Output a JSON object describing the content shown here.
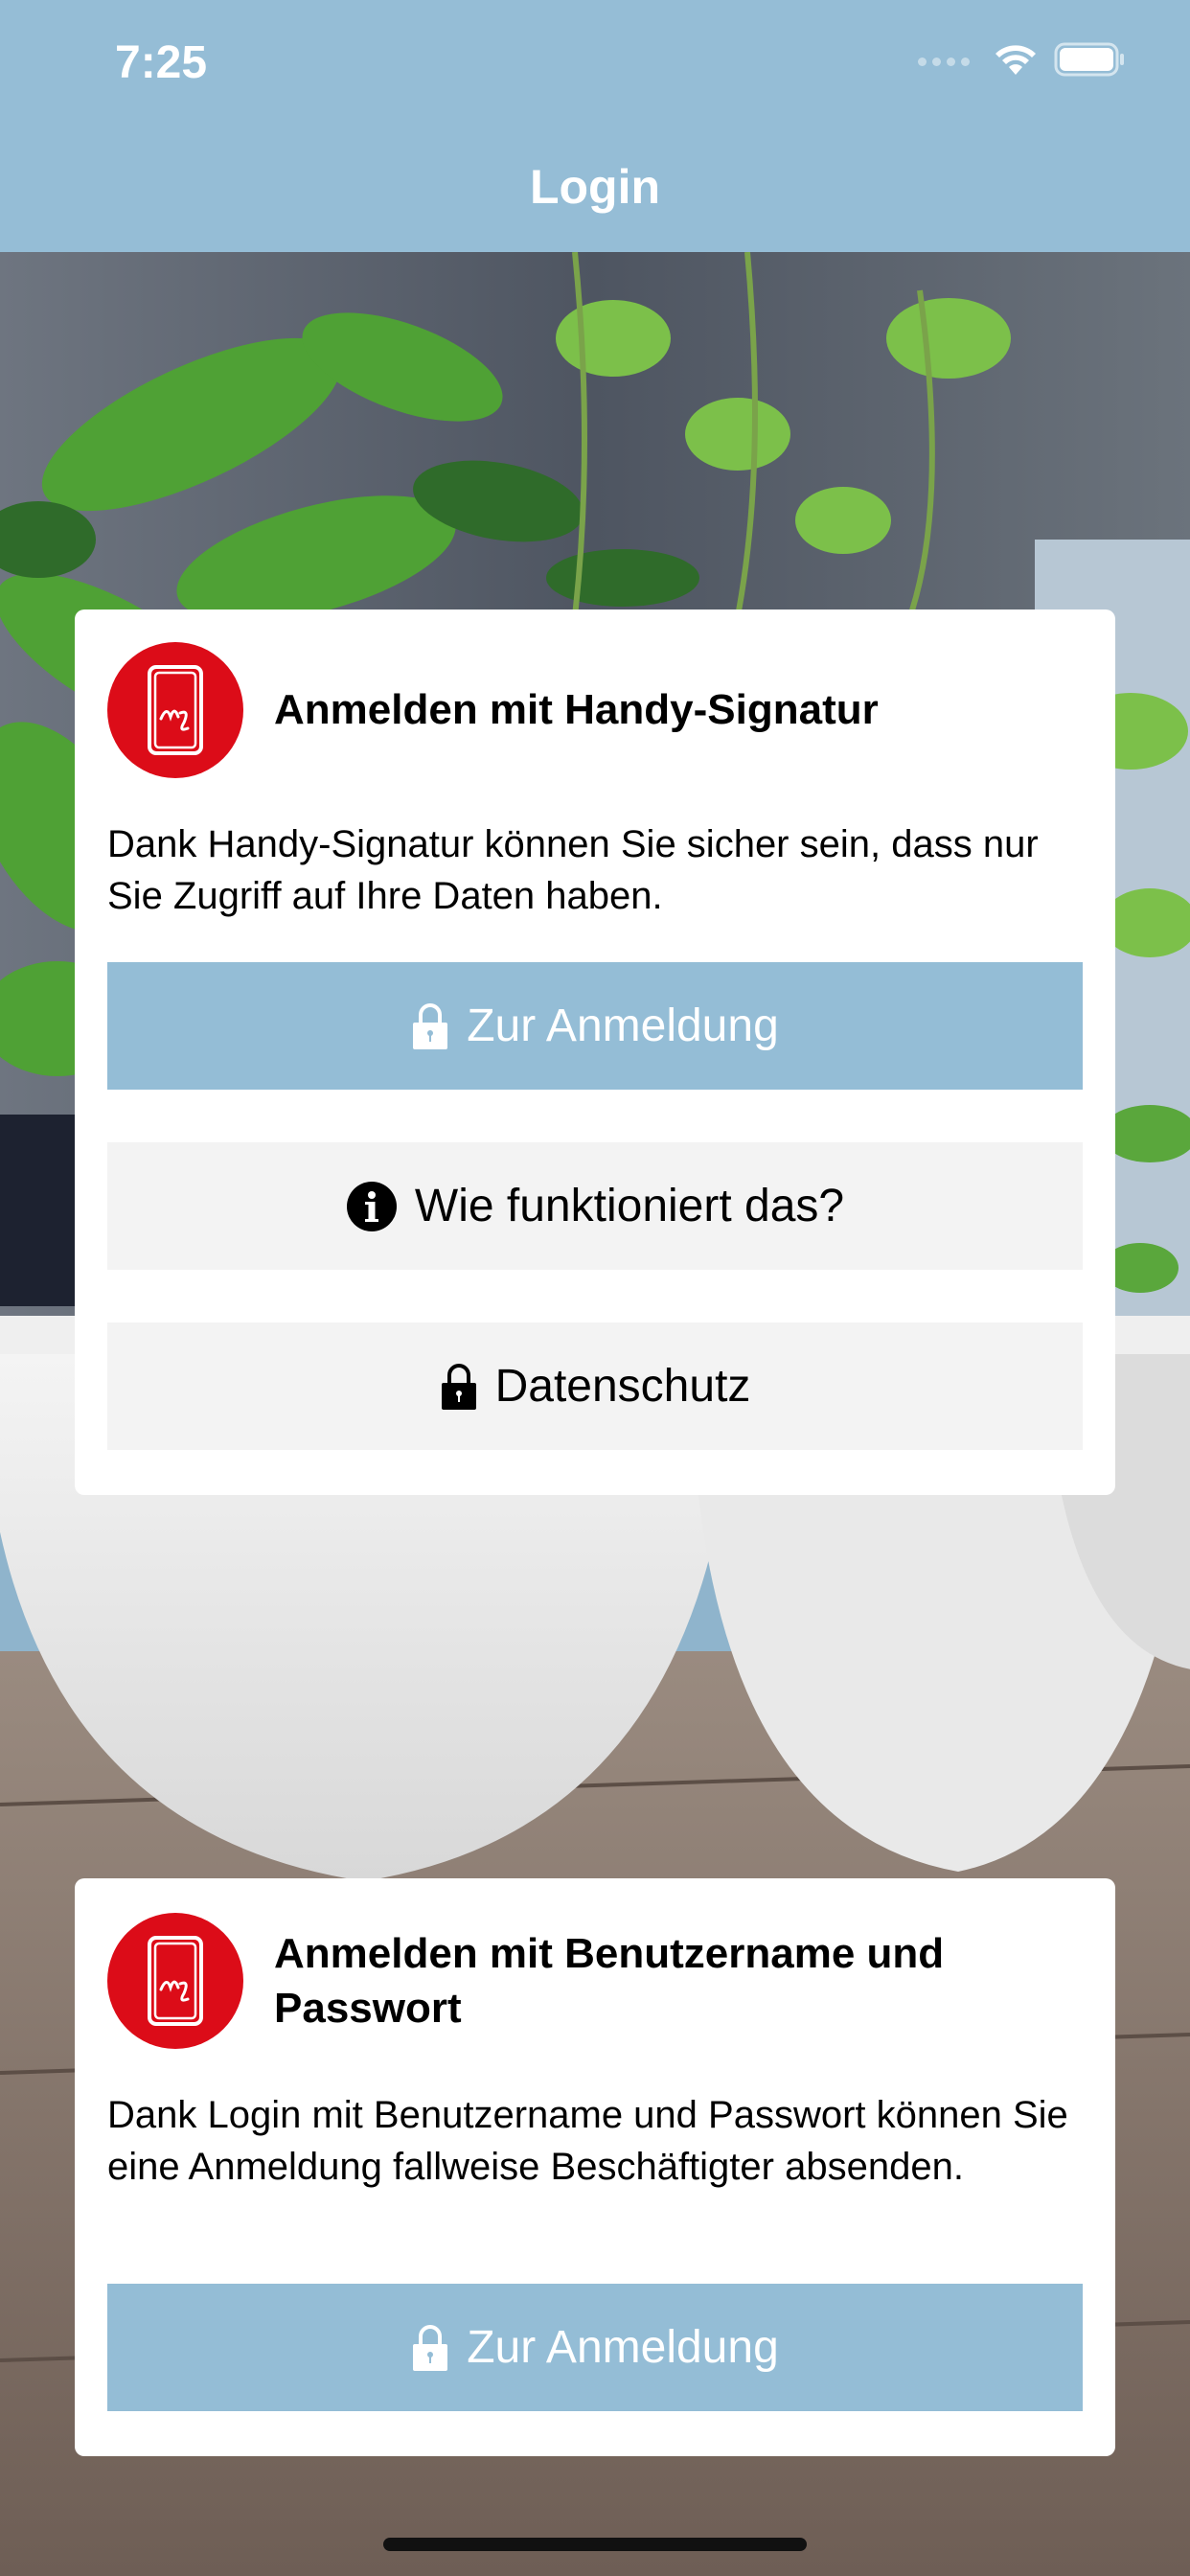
{
  "status_bar": {
    "time": "7:25"
  },
  "nav": {
    "title": "Login"
  },
  "colors": {
    "header_bg": "#95bdd6",
    "primary_button": "#94bdd6",
    "secondary_button": "#f3f3f3",
    "logo_red": "#dc0c18"
  },
  "handy_signatur_card": {
    "logo_icon": "mobile-signature-icon",
    "title": "Anmelden mit Handy-Signatur",
    "description": "Dank Handy-Signatur können Sie sicher sein, dass nur Sie Zugriff auf Ihre Daten haben.",
    "login_button": {
      "label": "Zur Anmeldung",
      "icon": "lock-icon"
    },
    "info_button": {
      "label": "Wie funktioniert das?",
      "icon": "info-icon"
    },
    "privacy_button": {
      "label": "Datenschutz",
      "icon": "lock-icon"
    }
  },
  "password_card": {
    "logo_icon": "mobile-signature-icon",
    "title": "Anmelden mit Benutzername und Passwort",
    "description": "Dank Login mit Benutzername und Passwort können Sie eine Anmeldung fallweise Beschäftigter absenden.",
    "login_button": {
      "label": "Zur Anmeldung",
      "icon": "lock-icon"
    }
  }
}
